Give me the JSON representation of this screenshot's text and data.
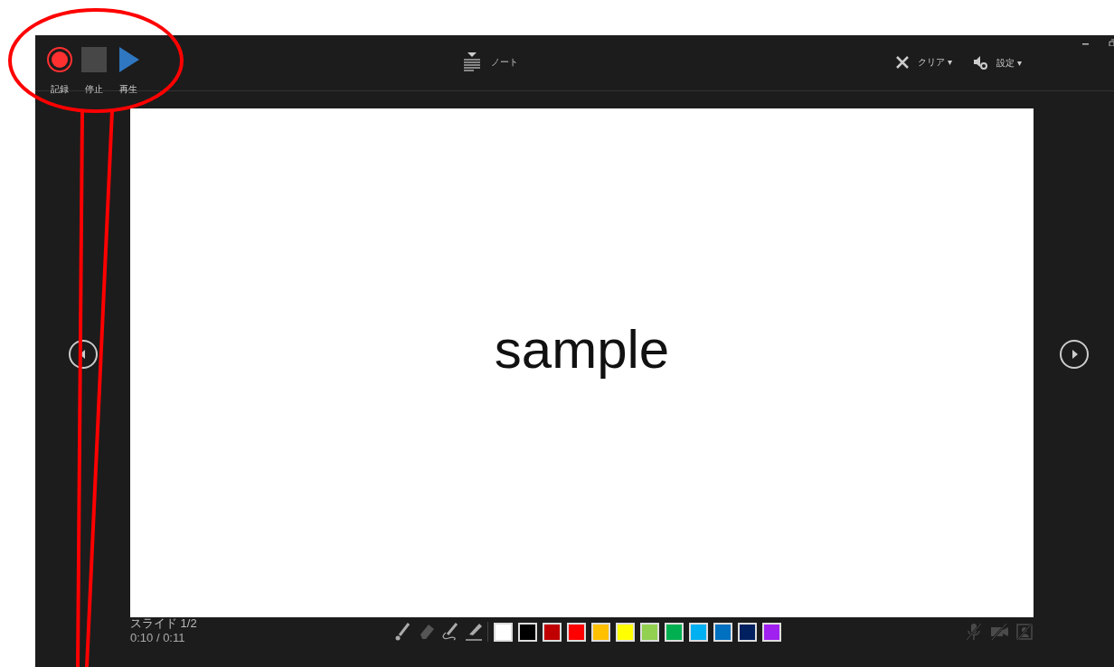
{
  "record_controls": [
    {
      "kind": "record",
      "label": "記録"
    },
    {
      "kind": "stop",
      "label": "停止"
    },
    {
      "kind": "play",
      "label": "再生"
    }
  ],
  "notes_button": {
    "label": "ノート"
  },
  "clear_button": {
    "label": "クリア ▾"
  },
  "settings_button": {
    "label": "設定 ▾"
  },
  "slide": {
    "text": "sample"
  },
  "slide_counter": "スライド 1/2",
  "timer": "0:10 / 0:11",
  "pen_tools": [
    {
      "kind": "laser",
      "disabled": false
    },
    {
      "kind": "eraser",
      "disabled": true
    },
    {
      "kind": "pen",
      "disabled": false
    },
    {
      "kind": "highlighter",
      "disabled": false
    }
  ],
  "ink_colors": [
    {
      "color": "#ffffff"
    },
    {
      "color": "#000000"
    },
    {
      "color": "#c00000"
    },
    {
      "color": "#ff0000"
    },
    {
      "color": "#ffc000"
    },
    {
      "color": "#ffff00"
    },
    {
      "color": "#92d050"
    },
    {
      "color": "#00b050"
    },
    {
      "color": "#00b0f0"
    },
    {
      "color": "#0070c0"
    },
    {
      "color": "#002060"
    },
    {
      "color": "#a020f0"
    }
  ],
  "media_toggles": [
    {
      "kind": "microphone",
      "on": false
    },
    {
      "kind": "camera",
      "on": false
    },
    {
      "kind": "preview",
      "on": false
    }
  ]
}
